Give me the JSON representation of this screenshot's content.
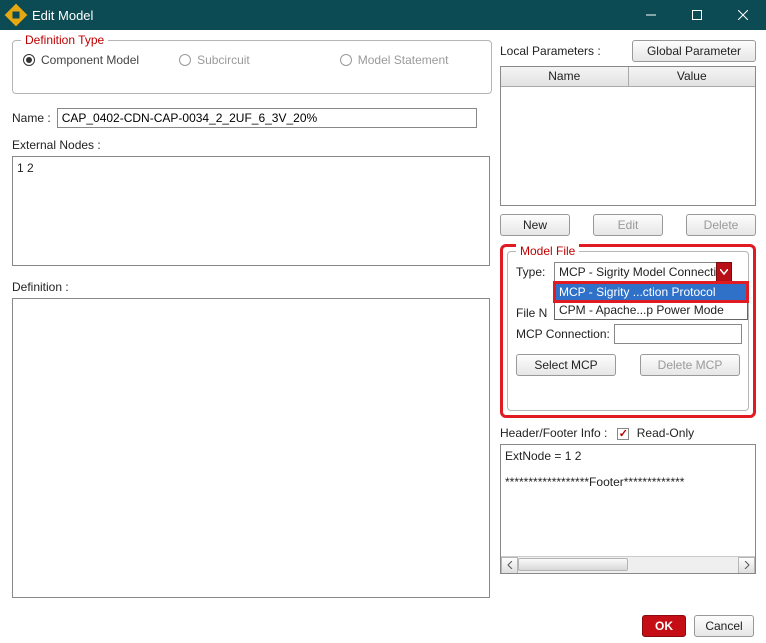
{
  "window": {
    "title": "Edit Model"
  },
  "definition_type": {
    "legend": "Definition Type",
    "options": {
      "component_model": "Component Model",
      "subcircuit": "Subcircuit",
      "model_statement": "Model Statement"
    },
    "selected": "component_model"
  },
  "name_label": "Name :",
  "name_value": "CAP_0402-CDN-CAP-0034_2_2UF_6_3V_20%",
  "external_nodes_label": "External Nodes :",
  "external_nodes_value": "1   2",
  "definition_label": "Definition :",
  "definition_value": "",
  "local_params_label": "Local Parameters :",
  "global_param_btn": "Global Parameter",
  "param_table": {
    "col_name": "Name",
    "col_value": "Value"
  },
  "param_btns": {
    "new": "New",
    "edit": "Edit",
    "delete": "Delete"
  },
  "model_file": {
    "legend": "Model File",
    "type_label": "Type:",
    "type_value": "MCP - Sigrity Model Connecti",
    "options": [
      "MCP - Sigrity ...ction Protocol",
      "CPM - Apache...p Power Mode"
    ],
    "file_label": "File N",
    "file_value": "",
    "mcp_conn_label": "MCP Connection:",
    "mcp_conn_value": "",
    "select_mcp": "Select MCP",
    "delete_mcp": "Delete MCP"
  },
  "hf_label": "Header/Footer Info :",
  "readonly_label": "Read-Only",
  "hf_text_line1": "ExtNode =  1 2",
  "hf_text_line2": "******************Footer*************",
  "footer": {
    "ok": "OK",
    "cancel": "Cancel"
  }
}
